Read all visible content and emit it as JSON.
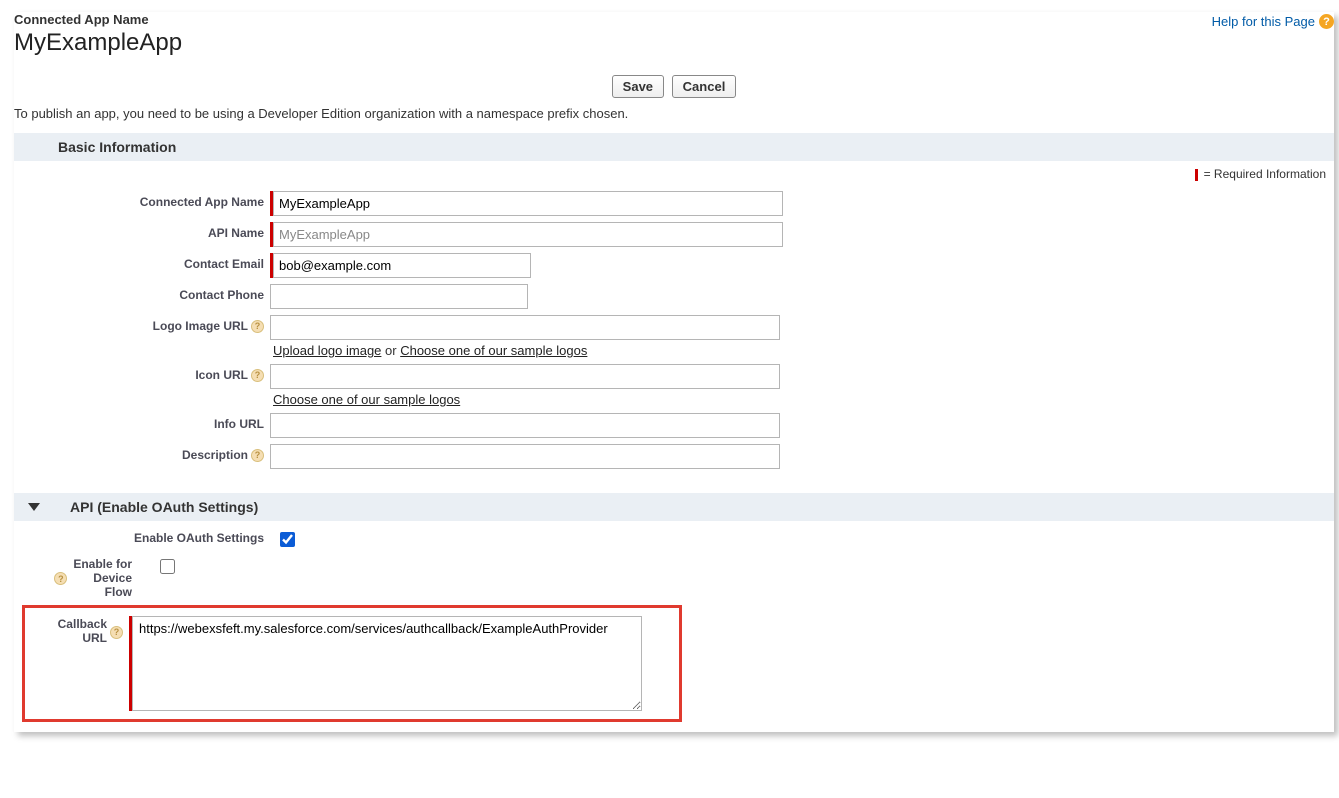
{
  "header": {
    "small_label": "Connected App Name",
    "title": "MyExampleApp",
    "help_text": "Help for this Page"
  },
  "buttons": {
    "save": "Save",
    "cancel": "Cancel"
  },
  "publish_note": "To publish an app, you need to be using a Developer Edition organization with a namespace prefix chosen.",
  "required_legend": "= Required Information",
  "sections": {
    "basic": "Basic Information",
    "api": "API (Enable OAuth Settings)"
  },
  "fields": {
    "connected_app_name": {
      "label": "Connected App Name",
      "value": "MyExampleApp"
    },
    "api_name": {
      "label": "API Name",
      "value": "MyExampleApp"
    },
    "contact_email": {
      "label": "Contact Email",
      "value": "bob@example.com"
    },
    "contact_phone": {
      "label": "Contact Phone",
      "value": ""
    },
    "logo_image_url": {
      "label": "Logo Image URL",
      "value": "",
      "link_upload": "Upload logo image",
      "or_text": " or ",
      "link_choose": "Choose one of our sample logos"
    },
    "icon_url": {
      "label": "Icon URL",
      "value": "",
      "link_choose": "Choose one of our sample logos"
    },
    "info_url": {
      "label": "Info URL",
      "value": ""
    },
    "description": {
      "label": "Description",
      "value": ""
    },
    "enable_oauth": {
      "label": "Enable OAuth Settings",
      "checked": true
    },
    "enable_device_flow": {
      "label": "Enable for Device Flow",
      "checked": false
    },
    "callback_url": {
      "label": "Callback URL",
      "value": "https://webexsfeft.my.salesforce.com/services/authcallback/ExampleAuthProvider"
    }
  }
}
